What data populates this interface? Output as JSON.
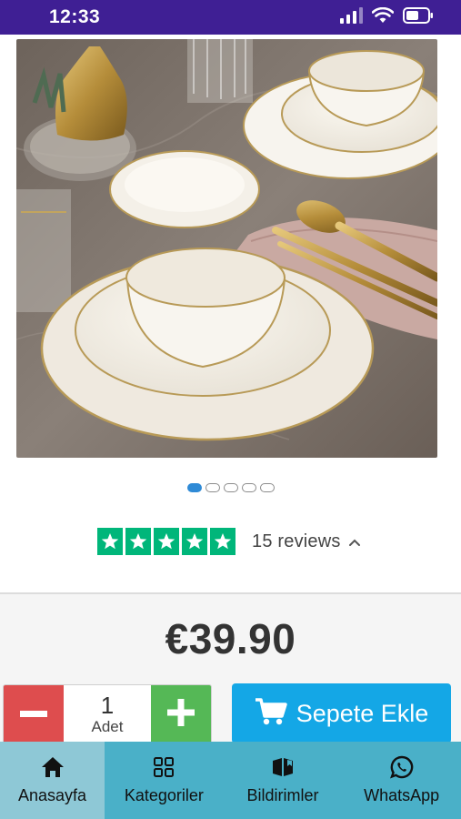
{
  "status_bar": {
    "time": "12:33",
    "icons": [
      "signal-icon",
      "wifi-icon",
      "battery-icon"
    ]
  },
  "product": {
    "image": "dinnerware-set-photo",
    "carousel": {
      "total": 5,
      "active_index": 0
    }
  },
  "reviews": {
    "stars": 5,
    "label": "15 reviews",
    "toggle_icon": "chevron-up-icon"
  },
  "price": "€39.90",
  "quantity": {
    "value": "1",
    "unit": "Adet"
  },
  "cart": {
    "label": "Sepete Ekle",
    "icon": "cart-icon"
  },
  "nav": {
    "items": [
      {
        "label": "Anasayfa",
        "icon": "home-icon"
      },
      {
        "label": "Kategoriler",
        "icon": "grid-icon"
      },
      {
        "label": "Bildirimler",
        "icon": "notification-icon"
      },
      {
        "label": "WhatsApp",
        "icon": "whatsapp-icon"
      }
    ]
  },
  "colors": {
    "status_bar": "#3f1f94",
    "trustpilot_green": "#00b67a",
    "minus": "#de4d4e",
    "plus": "#55b856",
    "cart": "#14a7e6",
    "nav_bar": "#4ab0c8",
    "nav_active": "#8ec8d6"
  }
}
